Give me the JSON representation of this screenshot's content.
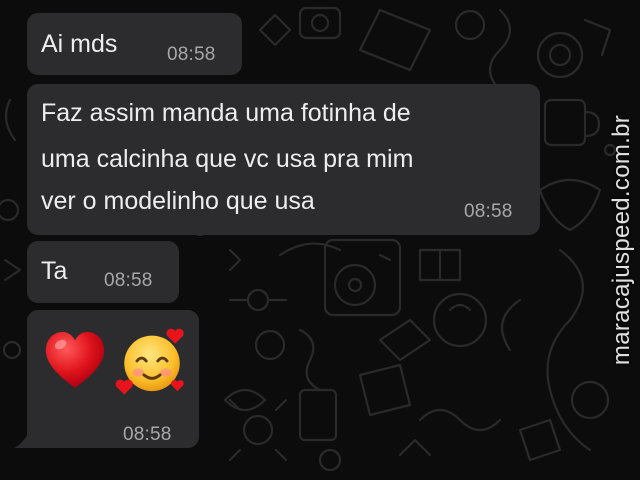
{
  "messages": [
    {
      "lines": [
        "Ai mds"
      ],
      "time": "08:58"
    },
    {
      "lines": [
        "Faz assim manda uma fotinha de",
        "uma calcinha que vc usa pra mim",
        "ver o modelinho que usa"
      ],
      "time": "08:58"
    },
    {
      "lines": [
        "Ta"
      ],
      "time": "08:58"
    },
    {
      "emojis": [
        "red-heart-icon",
        "smiling-face-with-hearts-icon"
      ],
      "time": "08:58"
    }
  ],
  "watermark": "maracajuspeed.com.br",
  "colors": {
    "background": "#0c0c0c",
    "bubble": "#2c2c2e",
    "text": "#ededed",
    "time": "#a7a7a7"
  }
}
